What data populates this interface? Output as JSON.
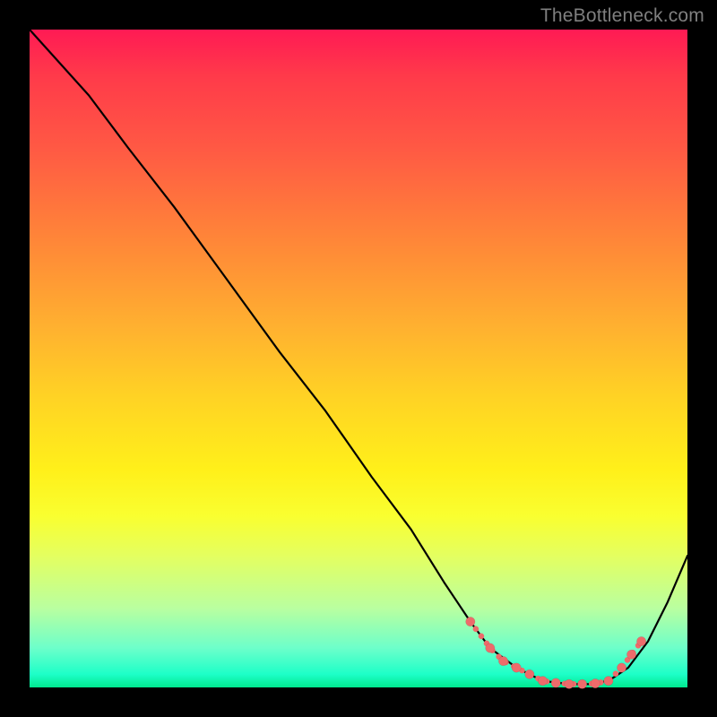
{
  "watermark": "TheBottleneck.com",
  "colors": {
    "background": "#000000",
    "curve": "#000000",
    "dot": "#ed6b6b",
    "gradient_from": "#ff1a54",
    "gradient_to": "#00e88f"
  },
  "chart_data": {
    "type": "line",
    "title": "",
    "xlabel": "",
    "ylabel": "",
    "xlim": [
      0,
      100
    ],
    "ylim": [
      0,
      100
    ],
    "grid": false,
    "series": [
      {
        "name": "curve",
        "x": [
          0,
          9,
          15,
          22,
          30,
          38,
          45,
          52,
          58,
          63,
          67,
          70,
          74,
          78,
          82,
          85,
          88,
          91,
          94,
          97,
          100
        ],
        "y": [
          100,
          90,
          82,
          73,
          62,
          51,
          42,
          32,
          24,
          16,
          10,
          6,
          3,
          1,
          0.5,
          0.5,
          1,
          3,
          7,
          13,
          20
        ]
      },
      {
        "name": "highlight-dots",
        "x": [
          67,
          70,
          72,
          74,
          76,
          78,
          80,
          82,
          84,
          86,
          88,
          90,
          91.5,
          93
        ],
        "y": [
          10,
          6,
          4,
          3,
          2,
          1,
          0.7,
          0.5,
          0.5,
          0.6,
          1,
          3,
          5,
          7
        ]
      }
    ],
    "annotations": []
  }
}
